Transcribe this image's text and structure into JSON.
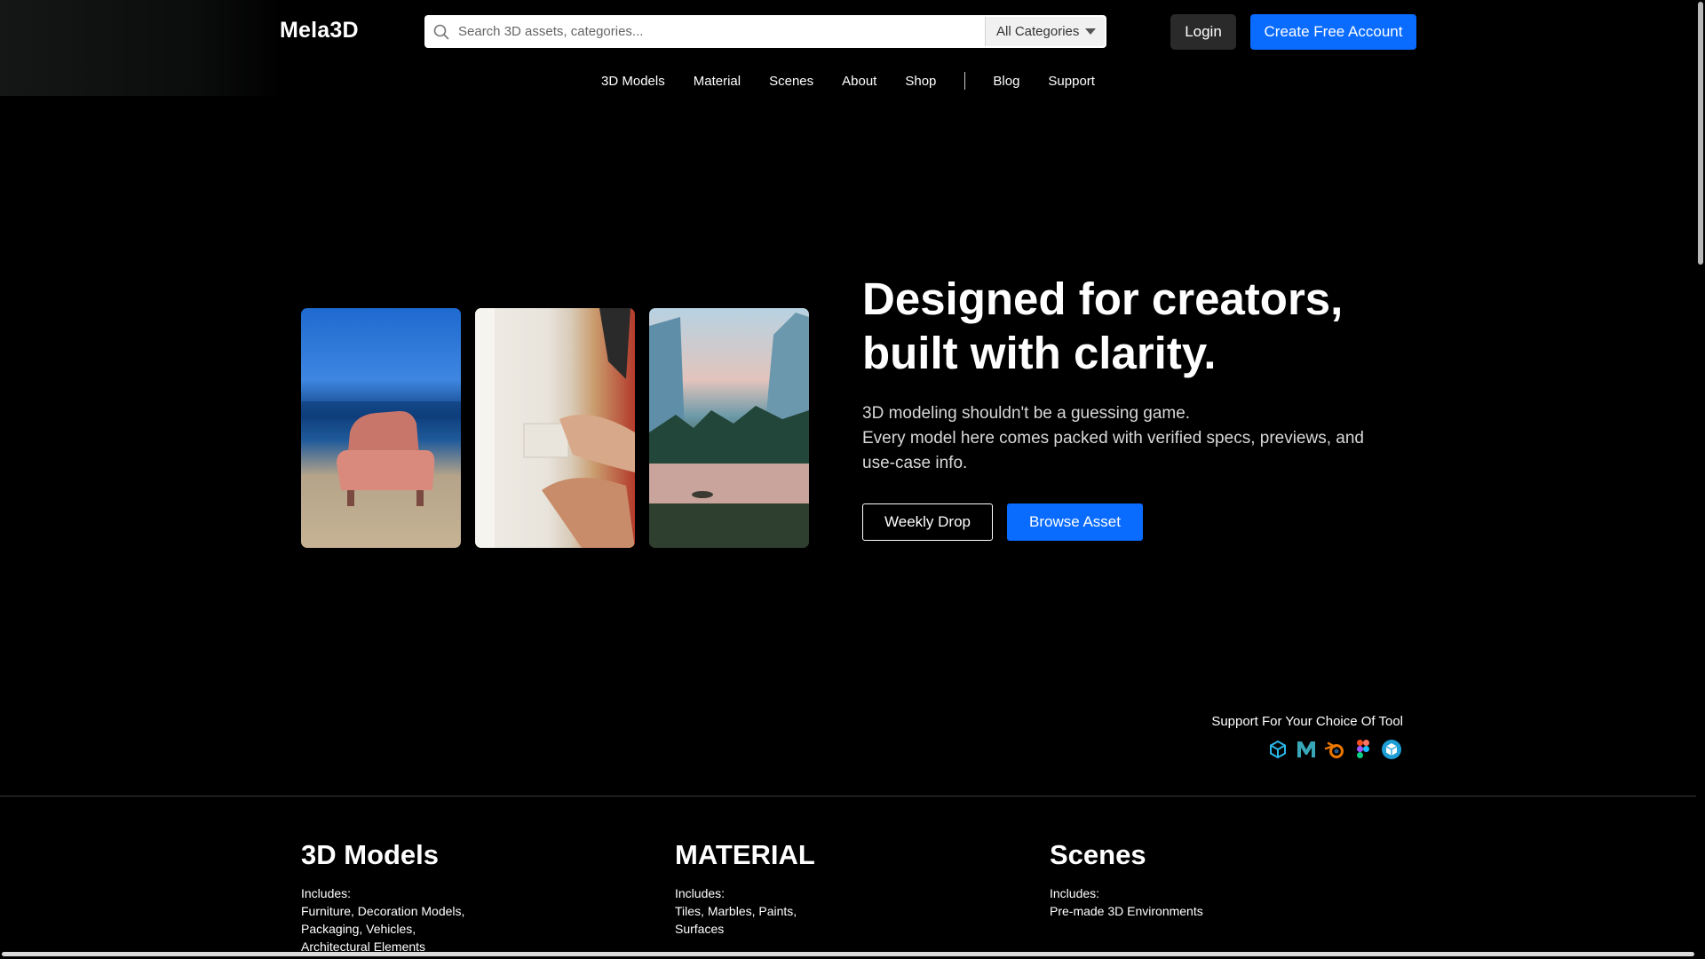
{
  "header": {
    "logo": "Mela3D",
    "search": {
      "placeholder": "Search 3D assets, categories..."
    },
    "category_select": {
      "value": "All Categories"
    },
    "login_label": "Login",
    "create_account_label": "Create Free Account"
  },
  "nav": {
    "items": [
      "3D Models",
      "Material",
      "Scenes",
      "About",
      "Shop",
      "Blog",
      "Support"
    ]
  },
  "hero": {
    "title_line1": "Designed for creators,",
    "title_line2": "built with clarity.",
    "subtitle_line1": "3D modeling shouldn't be a guessing game.",
    "subtitle_line2": "Every model here comes packed with verified specs, previews, and use-case info.",
    "weekly_drop_label": "Weekly Drop",
    "browse_asset_label": "Browse Asset",
    "images": [
      "armchair-on-beach",
      "hand-on-wall-panel",
      "mountain-lake-landscape"
    ]
  },
  "tools": {
    "label": "Support For Your Choice Of Tool",
    "icons": [
      "sketchup-icon",
      "maya-icon",
      "blender-icon",
      "figma-icon",
      "3dsmax-icon"
    ]
  },
  "categories": [
    {
      "title": "3D Models",
      "includes": "Includes:",
      "list": "Furniture, Decoration Models,\nPackaging, Vehicles,\nArchitectural Elements"
    },
    {
      "title": "MATERIAL",
      "includes": "Includes:",
      "list": "Tiles, Marbles, Paints,\nSurfaces"
    },
    {
      "title": "Scenes",
      "includes": "Includes:",
      "list": "Pre-made 3D Environments"
    }
  ],
  "colors": {
    "accent": "#0a6cff",
    "background": "#000000"
  }
}
